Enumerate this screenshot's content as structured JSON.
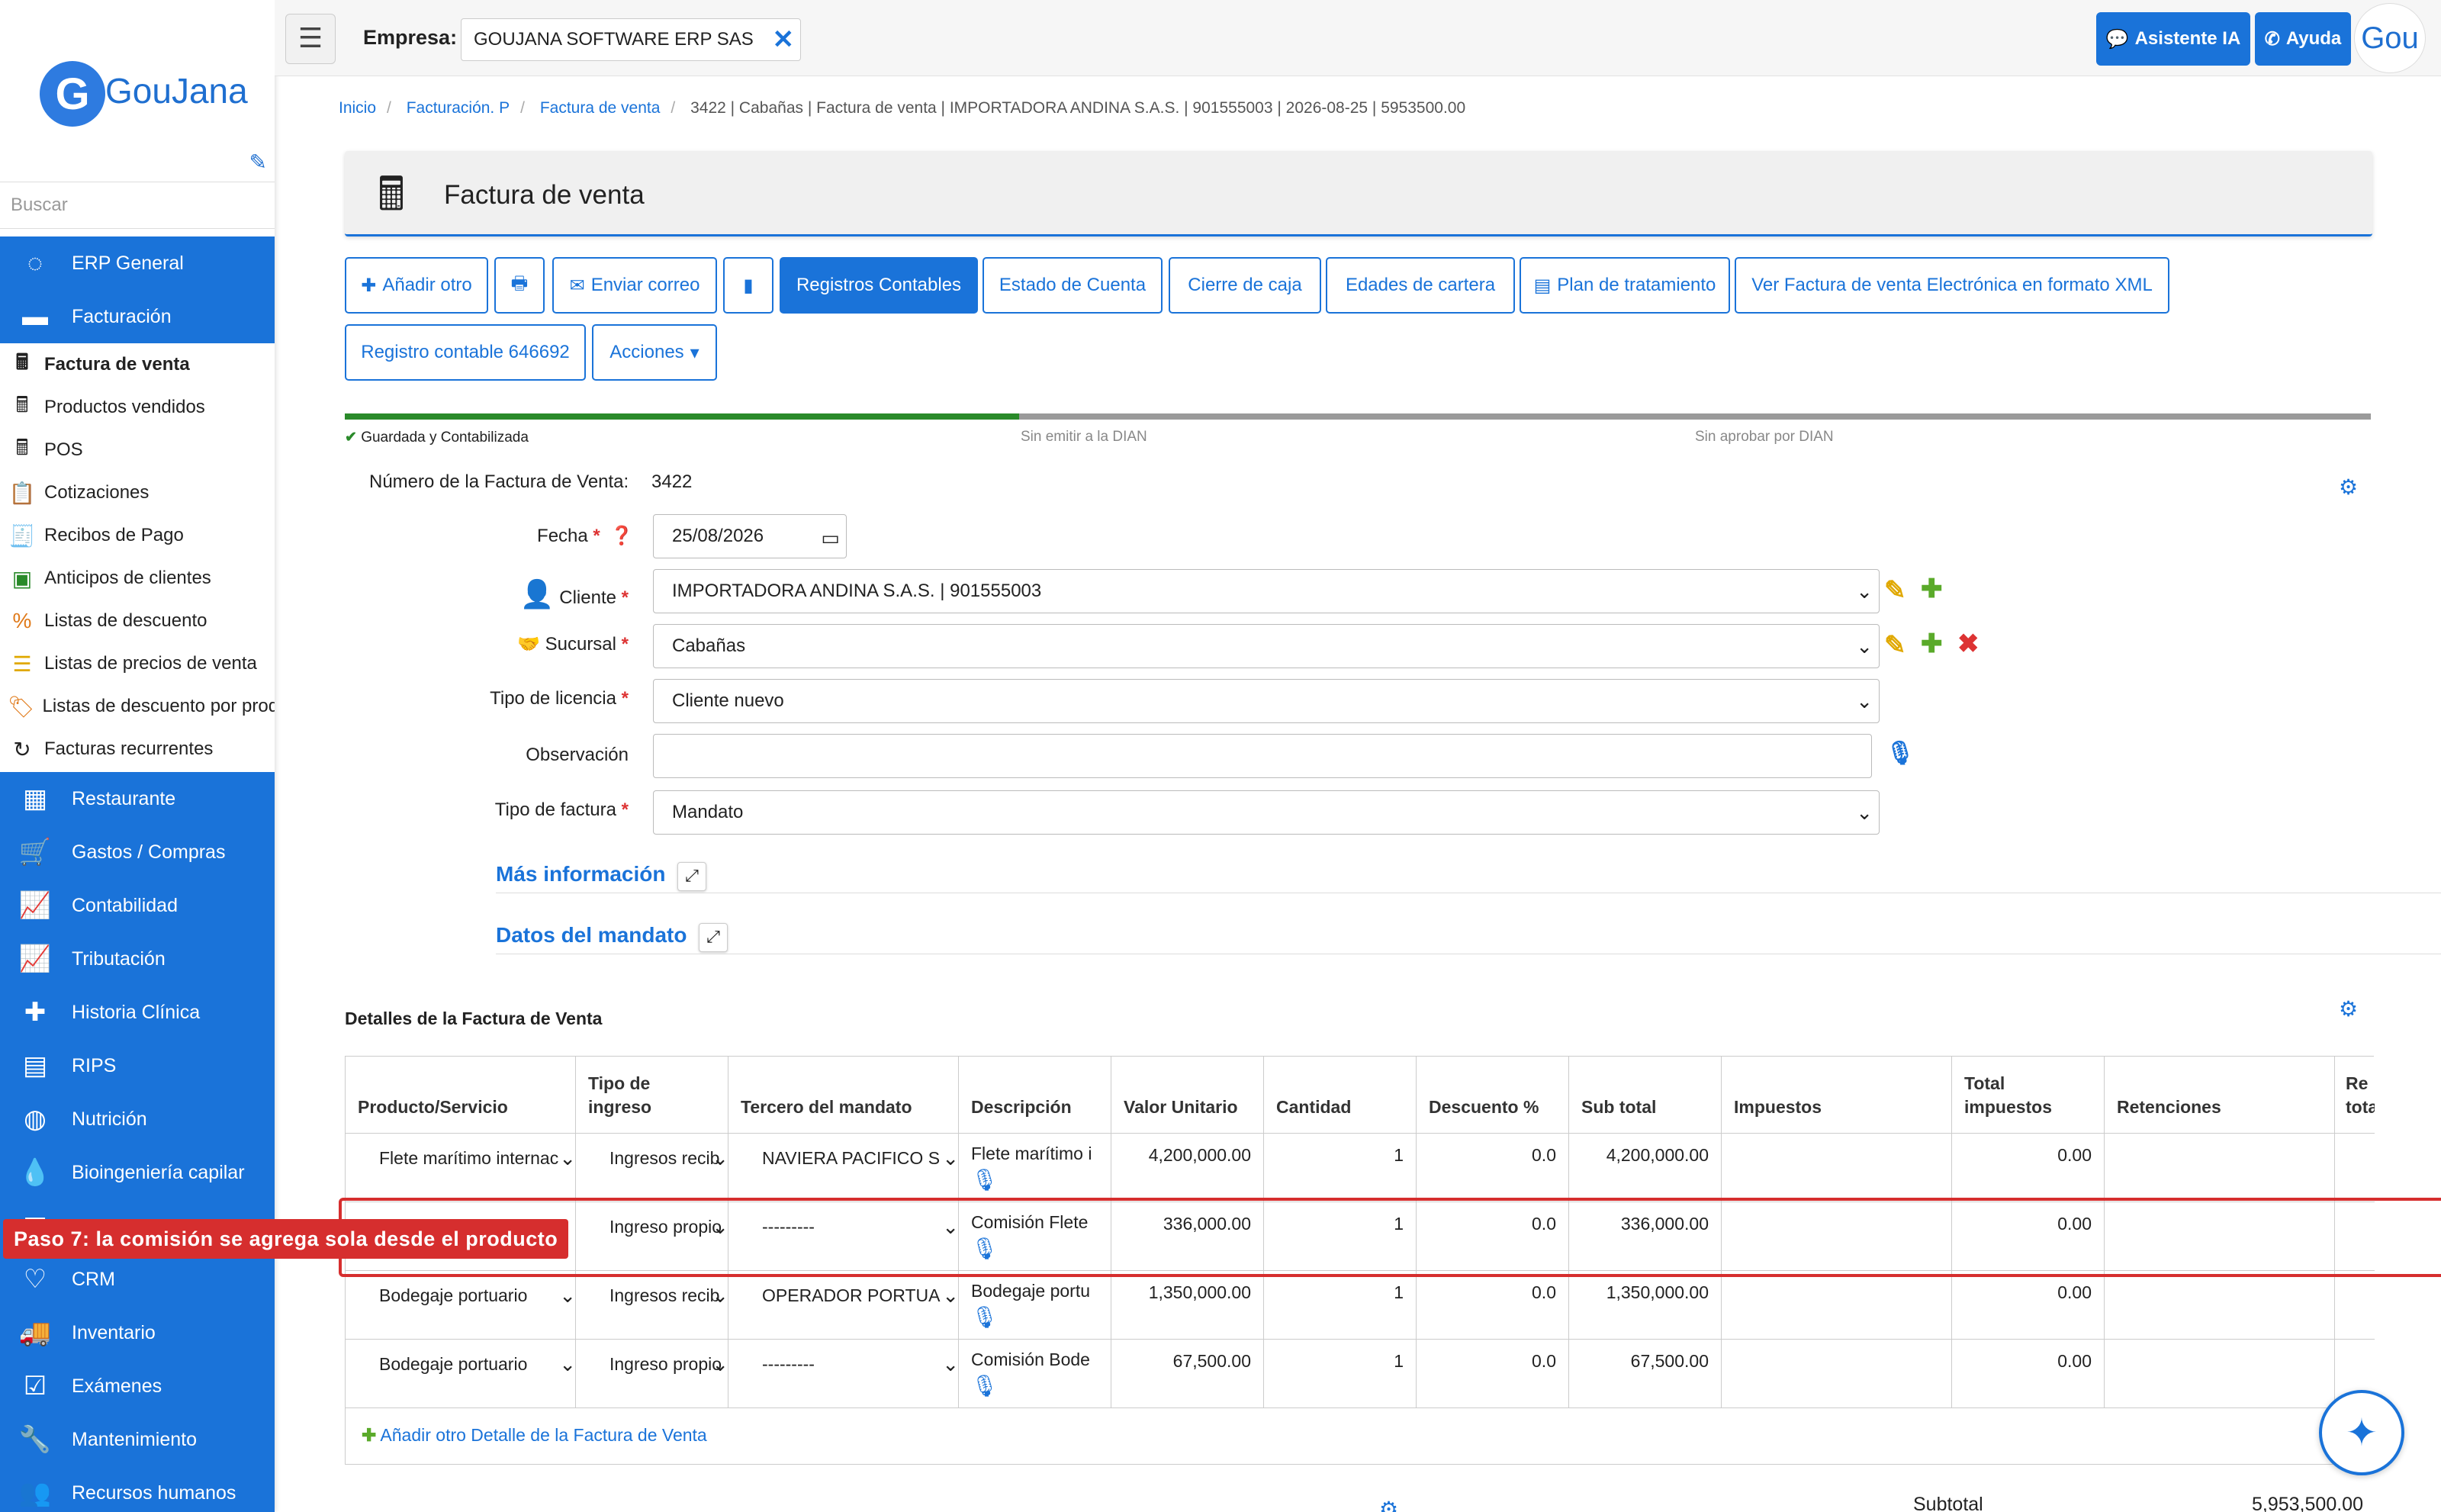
{
  "app": {
    "logo_text": "GouJana",
    "logo_mark": "G",
    "avatar_text": "Gou"
  },
  "sidebar": {
    "search_placeholder": "Buscar",
    "top_items": [
      {
        "label": "ERP General",
        "icon": "circle-notch-icon"
      },
      {
        "label": "Facturación",
        "icon": "credit-card-icon"
      }
    ],
    "sub_items": [
      {
        "label": "Factura de venta",
        "icon": "cash-register-icon",
        "active": true
      },
      {
        "label": "Productos vendidos",
        "icon": "cash-register-icon"
      },
      {
        "label": "POS",
        "icon": "cash-register-icon"
      },
      {
        "label": "Cotizaciones",
        "icon": "clipboard-icon"
      },
      {
        "label": "Recibos de Pago",
        "icon": "receipt-icon"
      },
      {
        "label": "Anticipos de clientes",
        "icon": "banknote-icon"
      },
      {
        "label": "Listas de descuento",
        "icon": "percent-icon"
      },
      {
        "label": "Listas de precios de venta",
        "icon": "price-list-icon"
      },
      {
        "label": "Listas de descuento por prod",
        "icon": "tag-icon"
      },
      {
        "label": "Facturas recurrentes",
        "icon": "recurring-icon"
      }
    ],
    "bottom_items": [
      {
        "label": "Restaurante",
        "icon": "calendar-icon"
      },
      {
        "label": "Gastos / Compras",
        "icon": "cart-icon"
      },
      {
        "label": "Contabilidad",
        "icon": "chart-line-icon"
      },
      {
        "label": "Tributación",
        "icon": "chart-line-icon"
      },
      {
        "label": "Historia Clínica",
        "icon": "plus-square-icon"
      },
      {
        "label": "RIPS",
        "icon": "rips-icon"
      },
      {
        "label": "Nutrición",
        "icon": "scale-icon"
      },
      {
        "label": "Bioingeniería capilar",
        "icon": "drop-icon"
      },
      {
        "label": "CRM",
        "icon": "heart-icon"
      },
      {
        "label": "Inventario",
        "icon": "truck-icon"
      },
      {
        "label": "Exámenes",
        "icon": "check-square-icon"
      },
      {
        "label": "Mantenimiento",
        "icon": "wrench-icon"
      },
      {
        "label": "Recursos humanos",
        "icon": "users-icon"
      }
    ]
  },
  "topbar": {
    "menu_icon": "hamburger-icon",
    "empresa_label": "Empresa:",
    "empresa_value": "GOUJANA SOFTWARE ERP SAS",
    "asistente_label": "Asistente IA",
    "ayuda_label": "Ayuda"
  },
  "breadcrumb": {
    "items": [
      "Inicio",
      "Facturación. P",
      "Factura de venta"
    ],
    "current": "3422 | Cabañas | Factura de venta | IMPORTADORA ANDINA S.A.S. | 901555003 | 2026-08-25 | 5953500.00"
  },
  "page": {
    "title": "Factura de venta"
  },
  "toolbar": {
    "add_label": "Añadir otro",
    "email_label": "Enviar correo",
    "registros_label": "Registros Contables",
    "estado_label": "Estado de Cuenta",
    "cierre_label": "Cierre de caja",
    "edades_label": "Edades de cartera",
    "plan_label": "Plan de tratamiento",
    "xml_label": "Ver Factura de venta Electrónica en formato XML",
    "registro_label": "Registro contable 646692",
    "acciones_label": "Acciones"
  },
  "progress": {
    "fraction_complete": 0.333,
    "steps": [
      "Guardada y Contabilizada",
      "Sin emitir a la DIAN",
      "Sin aprobar por DIAN"
    ]
  },
  "form": {
    "numero_label": "Número de la Factura de Venta:",
    "numero_value": "3422",
    "fecha_label": "Fecha",
    "fecha_value": "25/08/2026",
    "cliente_label": "Cliente",
    "cliente_value": "IMPORTADORA ANDINA S.A.S. | 901555003",
    "sucursal_label": "Sucursal",
    "sucursal_value": "Cabañas",
    "licencia_label": "Tipo de licencia",
    "licencia_value": "Cliente nuevo",
    "observacion_label": "Observación",
    "observacion_value": "",
    "tipo_factura_label": "Tipo de factura",
    "tipo_factura_value": "Mandato",
    "mas_info_label": "Más información",
    "mandato_label": "Datos del mandato"
  },
  "details": {
    "title": "Detalles de la Factura de Venta",
    "columns": [
      "Producto/Servicio",
      "Tipo de ingreso",
      "Tercero del mandato",
      "Descripción",
      "Valor Unitario",
      "Cantidad",
      "Descuento %",
      "Sub total",
      "Impuestos",
      "Total impuestos",
      "Retenciones",
      "Re tota"
    ],
    "rows": [
      {
        "producto": "Flete marítimo internac",
        "tipo": "Ingresos recib",
        "tercero": "NAVIERA PACIFICO S",
        "descripcion": "Flete marítimo i",
        "valor": "4,200,000.00",
        "cantidad": "1",
        "descuento": "0.0",
        "subtotal": "4,200,000.00",
        "impuestos": "",
        "total_impuestos": "0.00"
      },
      {
        "producto": "",
        "tipo": "Ingreso propio",
        "tercero": "---------",
        "descripcion": "Comisión Flete",
        "valor": "336,000.00",
        "cantidad": "1",
        "descuento": "0.0",
        "subtotal": "336,000.00",
        "impuestos": "",
        "total_impuestos": "0.00"
      },
      {
        "producto": "Bodegaje portuario",
        "tipo": "Ingresos recib",
        "tercero": "OPERADOR PORTUA",
        "descripcion": "Bodegaje portu",
        "valor": "1,350,000.00",
        "cantidad": "1",
        "descuento": "0.0",
        "subtotal": "1,350,000.00",
        "impuestos": "",
        "total_impuestos": "0.00"
      },
      {
        "producto": "Bodegaje portuario",
        "tipo": "Ingreso propio",
        "tercero": "---------",
        "descripcion": "Comisión Bode",
        "valor": "67,500.00",
        "cantidad": "1",
        "descuento": "0.0",
        "subtotal": "67,500.00",
        "impuestos": "",
        "total_impuestos": "0.00"
      }
    ],
    "add_label": "Añadir otro Detalle de la Factura de Venta"
  },
  "callout": {
    "text": "Paso 7: la comisión se agrega sola desde el producto",
    "color": "#d62e2e"
  },
  "totals": {
    "subtotal_label": "Subtotal",
    "subtotal_value": "5,953,500.00"
  },
  "colors": {
    "primary": "#1a73d9",
    "progress_done": "#2a8a2a",
    "progress_pending": "#9a9a9a",
    "danger": "#d33",
    "success": "#5aaa2a",
    "edit": "#e0a800"
  }
}
